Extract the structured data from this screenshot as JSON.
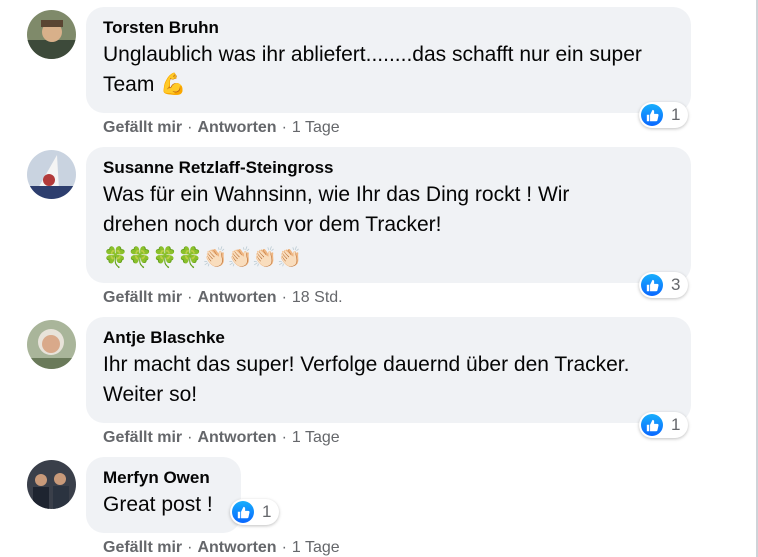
{
  "comments": [
    {
      "author": "Torsten Bruhn",
      "text": "Unglaublich was ihr abliefert........das schafft nur ein super\nTeam 💪",
      "reaction_count": "1",
      "like_label": "Gefällt mir",
      "reply_label": "Antworten",
      "time": "1 Tage"
    },
    {
      "author": "Susanne Retzlaff-Steingross",
      "text": "Was für ein Wahnsinn, wie Ihr das Ding rockt ! Wir\ndrehen noch durch vor dem Tracker!",
      "emojis": "🍀🍀🍀🍀👏🏻👏🏻👏🏻👏🏻",
      "reaction_count": "3",
      "like_label": "Gefällt mir",
      "reply_label": "Antworten",
      "time": "18 Std."
    },
    {
      "author": "Antje Blaschke",
      "text": "Ihr macht das super! Verfolge dauernd über den Tracker.\nWeiter so!",
      "reaction_count": "1",
      "like_label": "Gefällt mir",
      "reply_label": "Antworten",
      "time": "1 Tage"
    },
    {
      "author": "Merfyn Owen",
      "text": "Great post !",
      "reaction_count": "1",
      "like_label": "Gefällt mir",
      "reply_label": "Antworten",
      "time": "1 Tage"
    }
  ],
  "colors": {
    "bubble": "#f0f2f5",
    "meta": "#65676b",
    "like_blue": "#0866ff"
  }
}
